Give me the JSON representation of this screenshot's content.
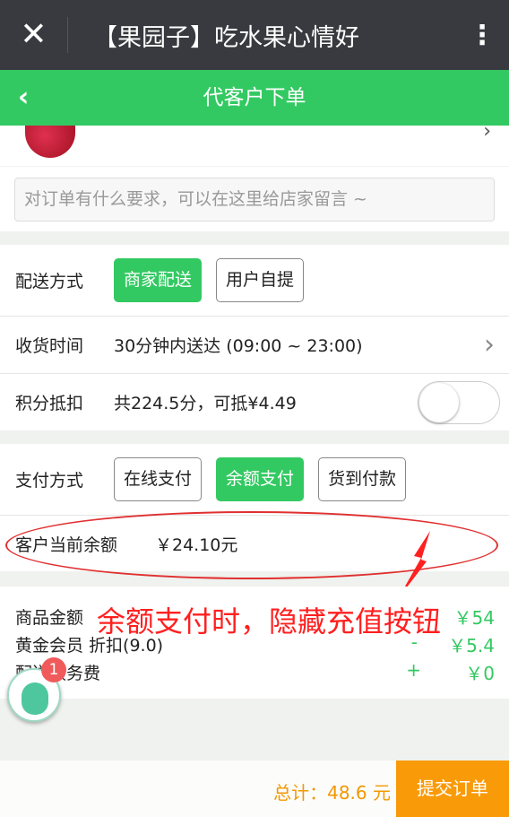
{
  "topbar": {
    "close_icon": "close-icon",
    "title": "【果园子】吃水果心情好",
    "more_icon": "more-vertical-icon"
  },
  "navbar": {
    "back_icon": "chevron-left-icon",
    "title": "代客户下单"
  },
  "message": {
    "placeholder": "对订单有什么要求，可以在这里给店家留言 ~"
  },
  "delivery": {
    "label": "配送方式",
    "options": [
      {
        "label": "商家配送",
        "selected": true
      },
      {
        "label": "用户自提",
        "selected": false
      }
    ]
  },
  "receive_time": {
    "label": "收货时间",
    "value": "30分钟内送达 (09:00 ~ 23:00)"
  },
  "points": {
    "label": "积分抵扣",
    "value": "共224.5分，可抵¥4.49",
    "enabled": false
  },
  "payment": {
    "label": "支付方式",
    "options": [
      {
        "label": "在线支付",
        "selected": false
      },
      {
        "label": "余额支付",
        "selected": true
      },
      {
        "label": "货到付款",
        "selected": false
      }
    ]
  },
  "balance": {
    "label": "客户当前余额",
    "value": "￥24.10元"
  },
  "annotation": "余额支付时，隐藏充值按钮",
  "summary": [
    {
      "label": "商品金额",
      "sign": "",
      "value": "￥54"
    },
    {
      "label": "黄金会员 折扣(9.0)",
      "sign": "-",
      "value": "￥5.4"
    },
    {
      "label": "配送服务费",
      "sign": "+",
      "value": "￥0"
    }
  ],
  "customer_service": {
    "badge": "1"
  },
  "footer": {
    "total": "总计：48.6 元",
    "submit": "提交订单"
  },
  "colors": {
    "primary": "#33c962",
    "accent": "#f99b09",
    "annotation": "#ff2020"
  }
}
